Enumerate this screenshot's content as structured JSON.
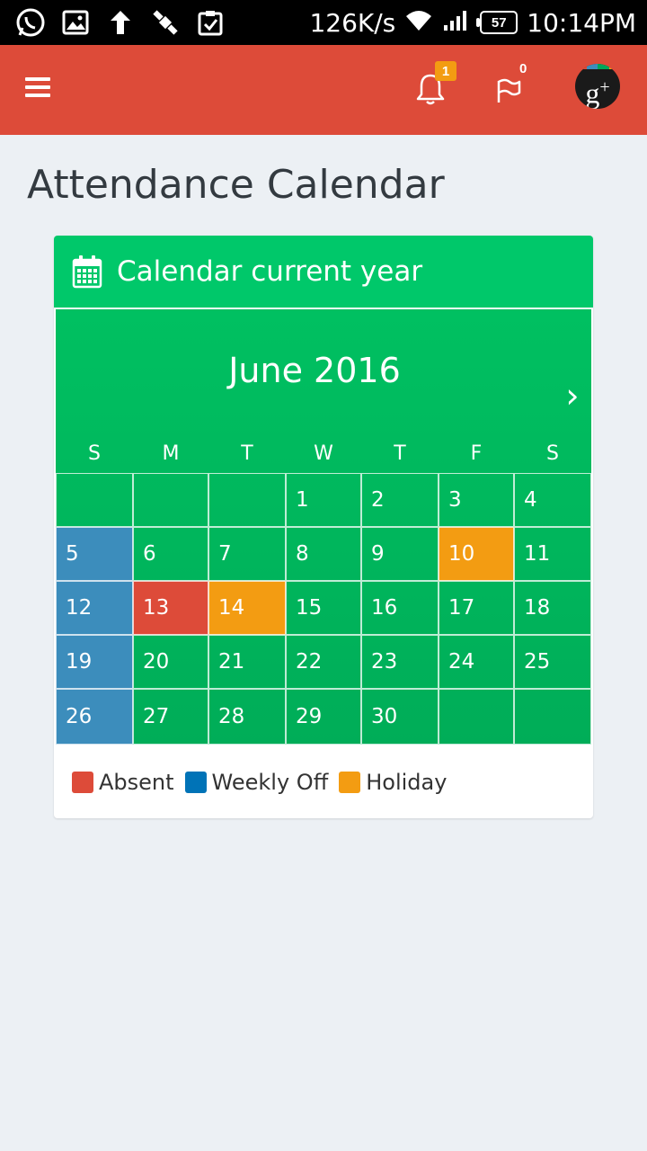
{
  "status_bar": {
    "speed": "126K/s",
    "battery": "57",
    "time": "10:14PM",
    "icons": [
      "whatsapp-icon",
      "gallery-icon",
      "upload-icon",
      "satellite-icon",
      "clipboard-check-icon",
      "wifi-icon",
      "signal-icon"
    ]
  },
  "app_bar": {
    "notifications_count": "1",
    "flags_count": "0",
    "color": "#dd4b39"
  },
  "page": {
    "title": "Attendance Calendar"
  },
  "box": {
    "title": "Calendar current year",
    "header_color": "#00c86a"
  },
  "calendar": {
    "month_label": "June 2016",
    "next_label": "›",
    "weekdays": [
      "S",
      "M",
      "T",
      "W",
      "T",
      "F",
      "S"
    ],
    "weeks": [
      [
        "",
        "",
        "",
        "1",
        "2",
        "3",
        "4"
      ],
      [
        "5",
        "6",
        "7",
        "8",
        "9",
        "10",
        "11"
      ],
      [
        "12",
        "13",
        "14",
        "15",
        "16",
        "17",
        "18"
      ],
      [
        "19",
        "20",
        "21",
        "22",
        "23",
        "24",
        "25"
      ],
      [
        "26",
        "27",
        "28",
        "29",
        "30",
        "",
        ""
      ]
    ],
    "day_status": {
      "5": "weekly",
      "10": "holiday",
      "12": "weekly",
      "13": "absent",
      "14": "holiday",
      "19": "weekly",
      "26": "weekly"
    }
  },
  "legend": [
    {
      "label": "Absent",
      "color": "#dd4b39"
    },
    {
      "label": "Weekly Off",
      "color": "#0073b7"
    },
    {
      "label": "Holiday",
      "color": "#f39c12"
    }
  ]
}
